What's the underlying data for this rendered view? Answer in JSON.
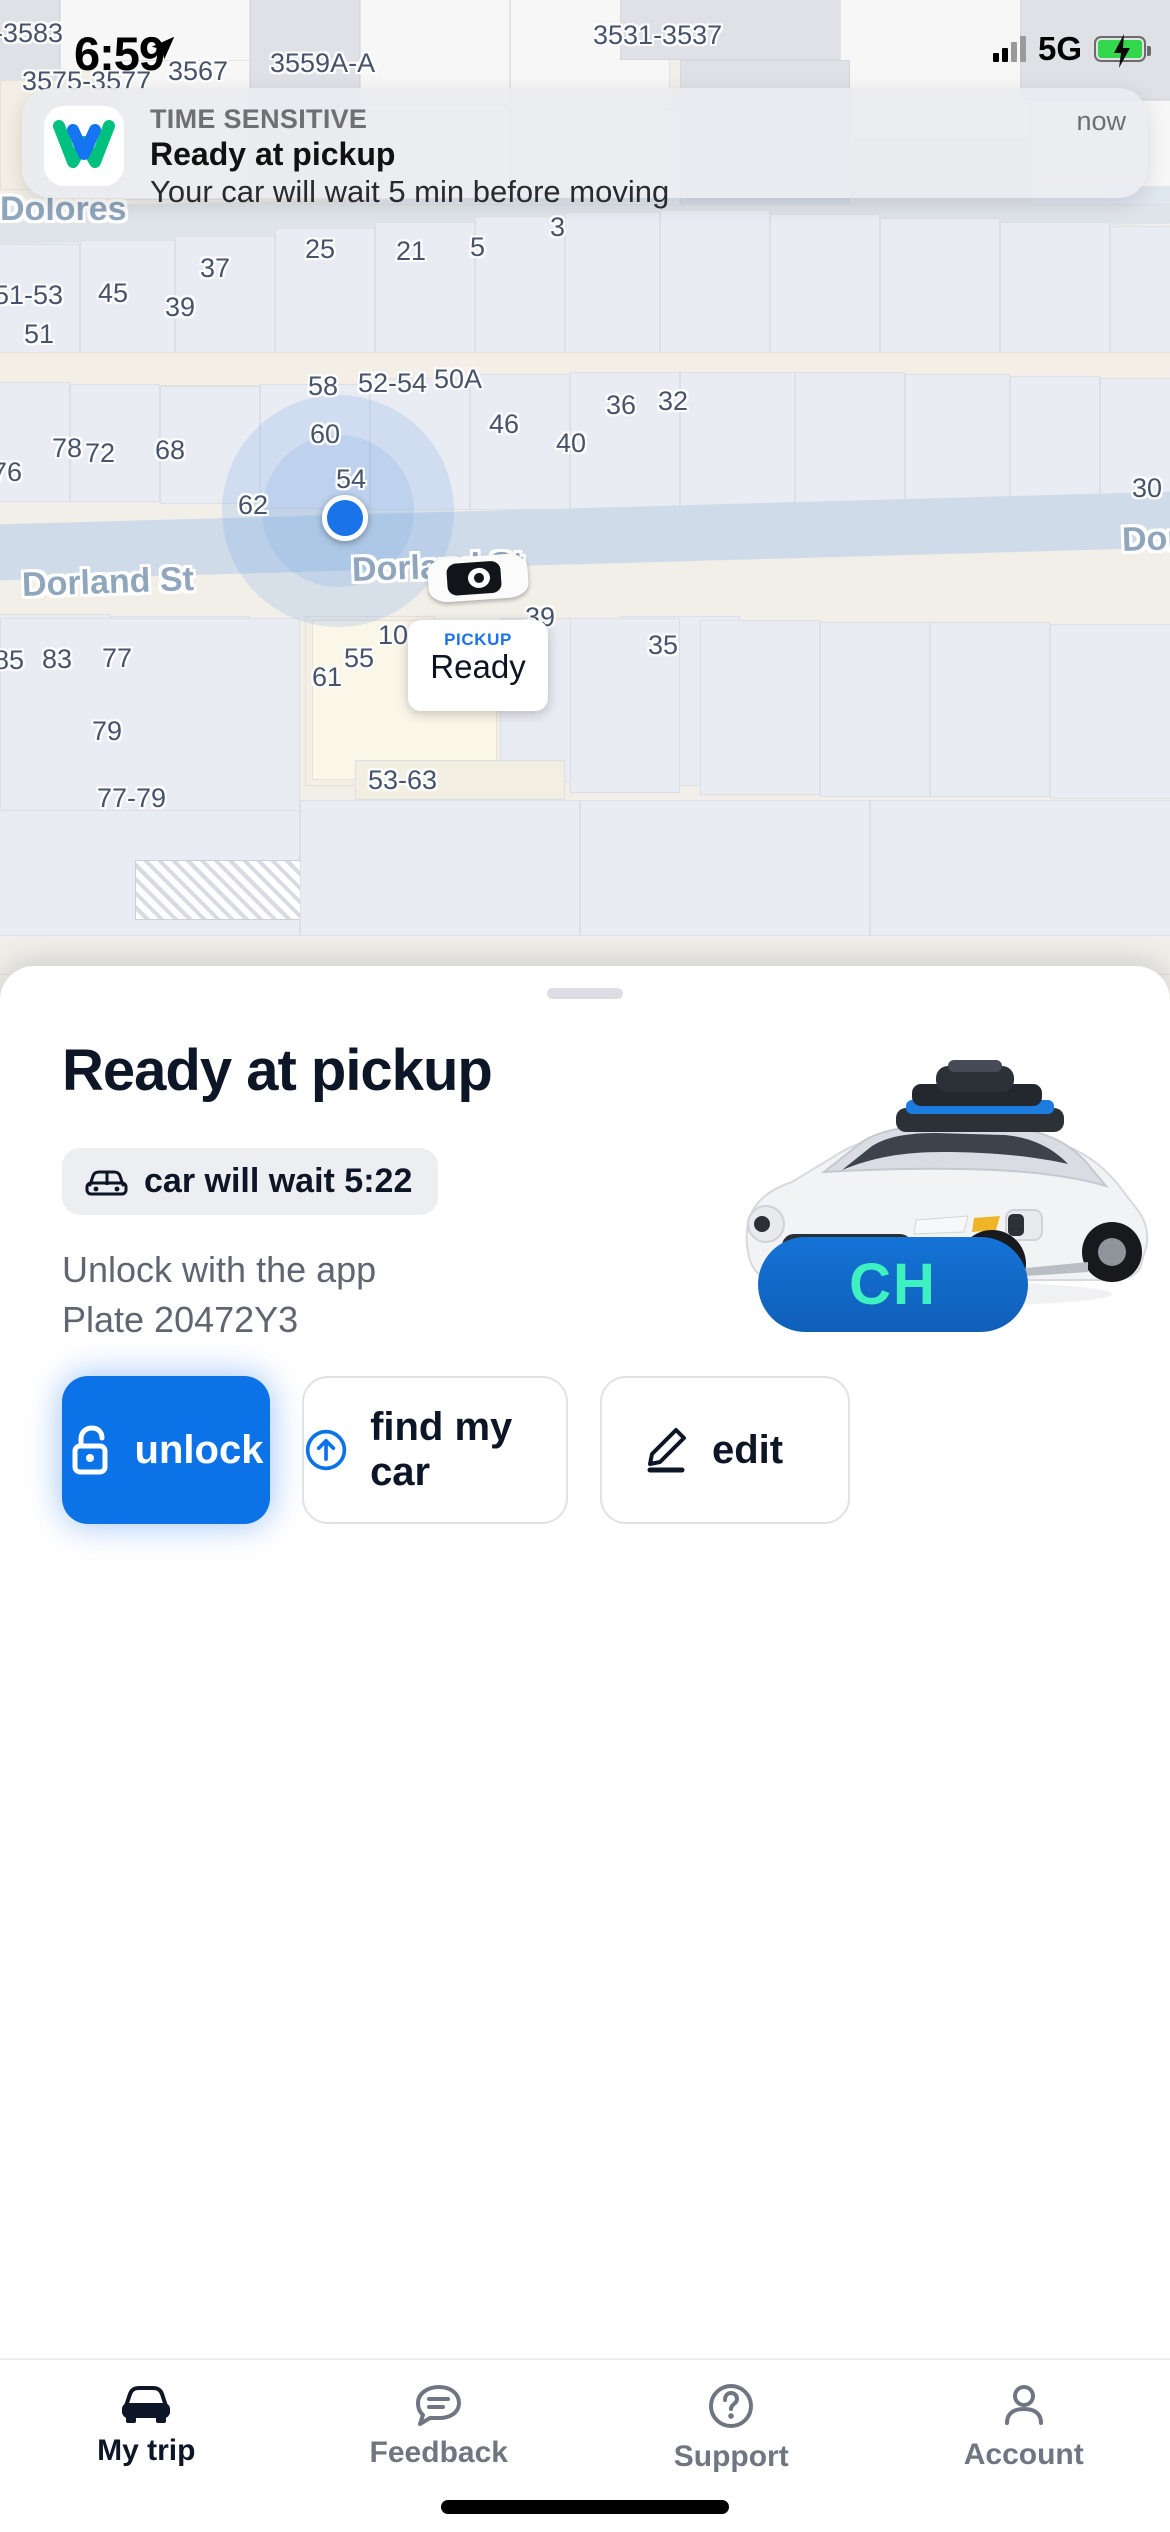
{
  "status_bar": {
    "time": "6:59",
    "location_icon": "location-arrow-icon",
    "network": "5G",
    "signal_icon": "cellular-signal-icon",
    "battery_icon": "battery-charging-icon"
  },
  "notification": {
    "kicker": "TIME SENSITIVE",
    "title": "Ready at pickup",
    "body": "Your car will wait 5 min before moving",
    "time": "now",
    "app_icon": "waymo-logo-icon"
  },
  "map": {
    "street_labels": [
      "Dolores",
      "Dorland St",
      "Dorland St",
      "Dor"
    ],
    "address_labels": [
      "-3583",
      "3575-3577",
      "3567",
      "3559A-A",
      "3531-3537",
      "25",
      "21",
      "5",
      "3",
      "37",
      "45",
      "39",
      "51-53",
      "51",
      "58",
      "52-54",
      "50A",
      "60",
      "36",
      "32",
      "46",
      "40",
      "78",
      "72",
      "68",
      "76",
      "54",
      "62",
      "30",
      "85",
      "83",
      "77",
      "79",
      "77-79",
      "61",
      "55",
      "10",
      "39",
      "35",
      "53-63"
    ],
    "pickup_card": {
      "kicker": "PICKUP",
      "status": "Ready"
    },
    "user_marker": "blue-location-dot",
    "vehicle_marker": "car-top-view-icon"
  },
  "sheet": {
    "title": "Ready at pickup",
    "wait_pill": {
      "icon": "car-wait-icon",
      "text": "car will wait 5:22"
    },
    "unlock_hint": "Unlock with the app",
    "plate": "Plate 20472Y3",
    "car_photo": "waymo-jaguar-ipace-photo",
    "car_badge": "CH",
    "actions": [
      {
        "icon": "unlock-icon",
        "label": "unlock"
      },
      {
        "icon": "arrow-up-circle-icon",
        "label": "find my car"
      },
      {
        "icon": "pencil-icon",
        "label": "edit"
      }
    ]
  },
  "tabs": [
    {
      "icon": "car-icon",
      "label": "My trip",
      "active": true
    },
    {
      "icon": "chat-icon",
      "label": "Feedback",
      "active": false
    },
    {
      "icon": "question-icon",
      "label": "Support",
      "active": false
    },
    {
      "icon": "person-icon",
      "label": "Account",
      "active": false
    }
  ],
  "colors": {
    "accent_blue": "#0b72e8",
    "pickup_blue": "#1a73e8",
    "badge_teal": "#3ff0c0",
    "text_dark": "#0d1626",
    "text_muted": "#5f6672"
  }
}
